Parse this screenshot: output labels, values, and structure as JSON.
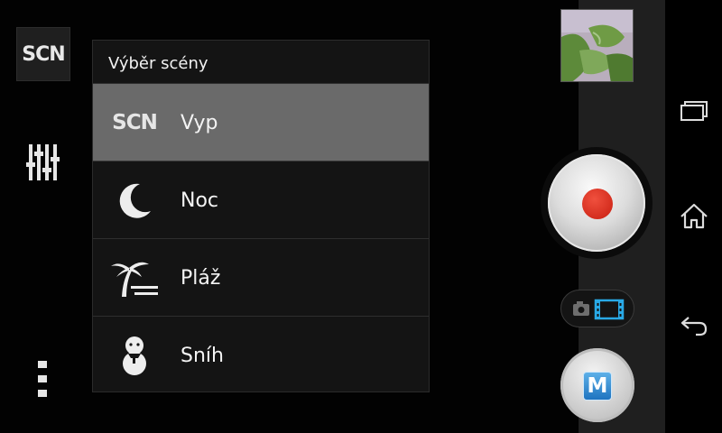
{
  "toolbar": {
    "scn_label": "SCN"
  },
  "dialog": {
    "title": "Výběr scény",
    "options": [
      {
        "icon": "scn-text-icon",
        "icon_text": "SCN",
        "label": "Vyp",
        "selected": true
      },
      {
        "icon": "moon-icon",
        "label": "Noc",
        "selected": false
      },
      {
        "icon": "beach-palm-icon",
        "label": "Pláž",
        "selected": false
      },
      {
        "icon": "snowman-icon",
        "label": "Sníh",
        "selected": false
      }
    ]
  },
  "controls": {
    "mode_dial_label": "M",
    "record_color": "#d62a1a",
    "accent_color": "#29a9e6"
  },
  "navbar": {
    "icons": [
      "recent-apps-icon",
      "home-icon",
      "back-icon"
    ]
  }
}
